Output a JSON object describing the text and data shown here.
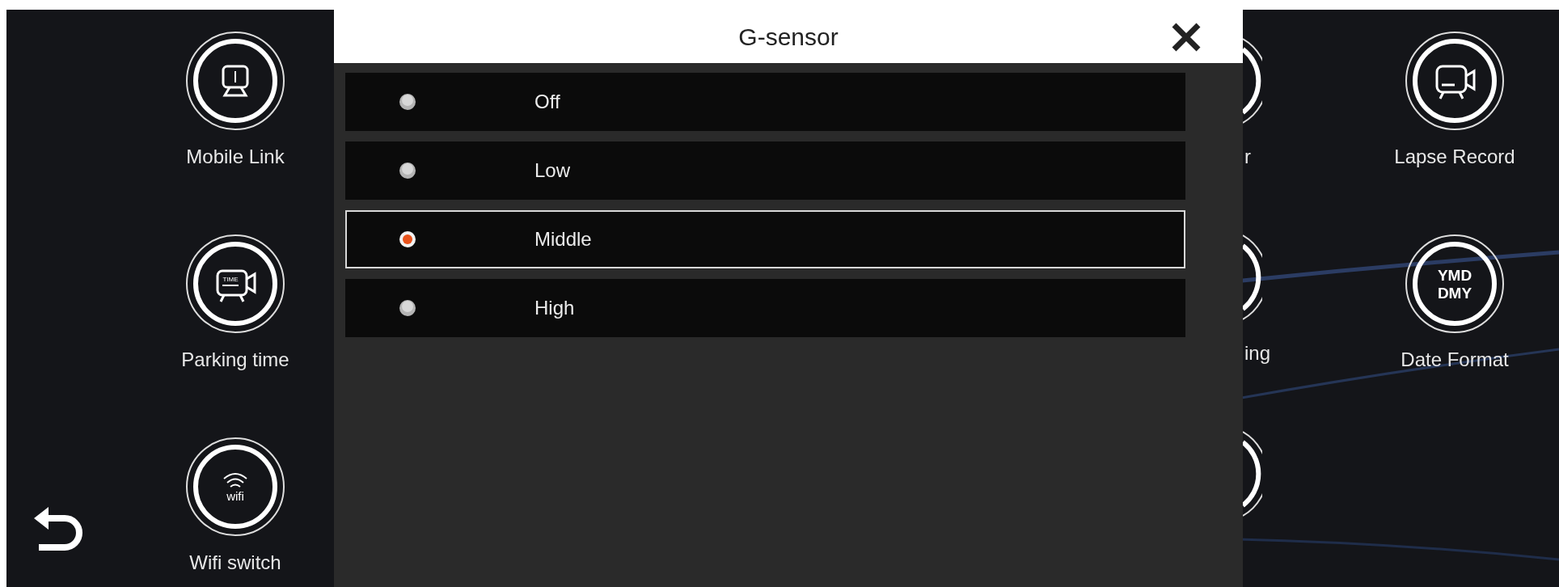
{
  "left_menu": [
    {
      "label": "Mobile Link",
      "kind": "monitor"
    },
    {
      "label": "Parking time",
      "kind": "timer_camera",
      "icon_text": [
        "TIME"
      ]
    },
    {
      "label": "Wifi switch",
      "kind": "wifi",
      "icon_text": [
        "wifi"
      ]
    }
  ],
  "hidden_menu": [
    {
      "kind": "ring",
      "label": "r"
    },
    {
      "kind": "ring",
      "label": "ing"
    },
    {
      "kind": "ring"
    }
  ],
  "right_menu": [
    {
      "label": "Lapse Record",
      "kind": "camera"
    },
    {
      "label": "Date Format",
      "kind": "text",
      "icon_text": [
        "YMD",
        "DMY"
      ]
    }
  ],
  "dialog": {
    "title": "G-sensor",
    "options": [
      {
        "label": "Off",
        "selected": false
      },
      {
        "label": "Low",
        "selected": false
      },
      {
        "label": "Middle",
        "selected": true
      },
      {
        "label": "High",
        "selected": false
      }
    ]
  }
}
